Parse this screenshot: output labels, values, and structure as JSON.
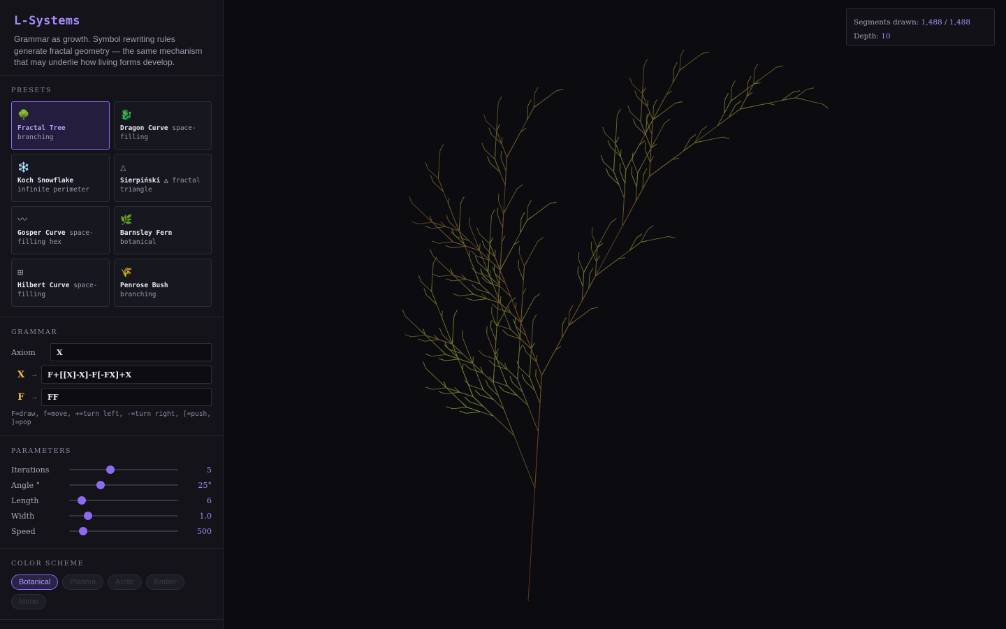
{
  "app": {
    "title": "L-Systems",
    "description": "Grammar as growth. Symbol rewriting rules generate fractal geometry — the same mechanism that may underlie how living forms develop."
  },
  "presets": {
    "label": "PRESETS",
    "items": [
      {
        "icon": "🌳",
        "name": "Fractal Tree",
        "tag": "branching",
        "active": true
      },
      {
        "icon": "🐉",
        "name": "Dragon Curve",
        "tag": "space-filling",
        "active": false
      },
      {
        "icon": "❄️",
        "name": "Koch Snowflake",
        "tag": "infinite perimeter",
        "active": false
      },
      {
        "icon": "△",
        "name": "Sierpiński △",
        "tag": "fractal triangle",
        "active": false
      },
      {
        "icon": "〰",
        "name": "Gosper Curve",
        "tag": "space-filling hex",
        "active": false
      },
      {
        "icon": "🌿",
        "name": "Barnsley Fern",
        "tag": "botanical",
        "active": false
      },
      {
        "icon": "⊞",
        "name": "Hilbert Curve",
        "tag": "space-filling",
        "active": false
      },
      {
        "icon": "🌾",
        "name": "Penrose Bush",
        "tag": "branching",
        "active": false
      }
    ]
  },
  "grammar": {
    "label": "GRAMMAR",
    "axiom_label": "Axiom",
    "axiom": "X",
    "rules": [
      {
        "symbol": "X",
        "arrow": "→",
        "value": "F+[[X]-X]-F[-FX]+X"
      },
      {
        "symbol": "F",
        "arrow": "→",
        "value": "FF"
      }
    ],
    "hint": "F=draw, f=move, +=turn left, -=turn right, [=push, ]=pop"
  },
  "parameters": {
    "label": "PARAMETERS",
    "items": [
      {
        "name": "Iterations",
        "value": "5",
        "fraction": 0.375
      },
      {
        "name": "Angle °",
        "value": "25°",
        "fraction": 0.29
      },
      {
        "name": "Length",
        "value": "6",
        "fraction": 0.115
      },
      {
        "name": "Width",
        "value": "1.0",
        "fraction": 0.17
      },
      {
        "name": "Speed",
        "value": "500",
        "fraction": 0.13
      }
    ]
  },
  "color_scheme": {
    "label": "COLOR SCHEME",
    "options": [
      "Botanical",
      "Plasma",
      "Arctic",
      "Ember",
      "Mono"
    ],
    "selected": "Botanical"
  },
  "stats": {
    "segments_label": "Segments drawn:",
    "segments_drawn": "1,488",
    "separator": "/",
    "segments_total": "1,488",
    "depth_label": "Depth:",
    "depth": "10"
  },
  "colors": {
    "accent": "#8b6cf0",
    "rule_symbol": "#f5c542",
    "branch_trunk": "#6b3f22",
    "branch_tip": "#7fb03a"
  }
}
